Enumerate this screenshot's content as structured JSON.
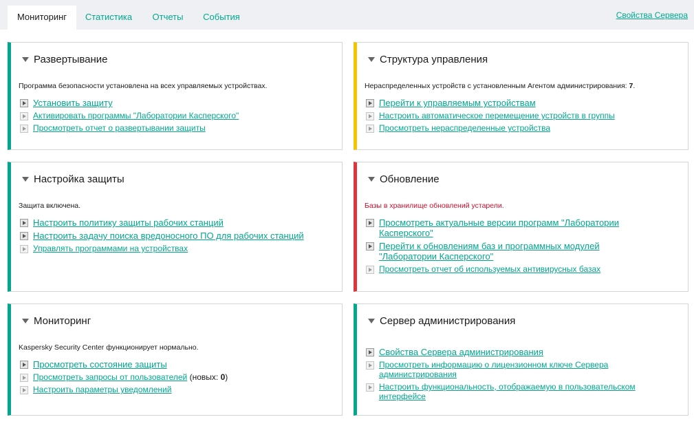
{
  "tabs": {
    "monitoring": "Мониторинг",
    "statistics": "Статистика",
    "reports": "Отчеты",
    "events": "События"
  },
  "server_properties_link": "Свойства Сервера",
  "colors": {
    "accent_green": "#00a88e",
    "warning_yellow": "#f5c400",
    "critical_red": "#e0343e"
  },
  "deployment": {
    "title": "Развертывание",
    "status": "Программа безопасности установлена на всех управляемых устройствах.",
    "links": [
      "Установить защиту",
      "Активировать программы \"Лаборатории Касперского\"",
      "Просмотреть отчет о развертывании защиты"
    ]
  },
  "management": {
    "title": "Структура управления",
    "status_prefix": "Нераспределенных устройств с установленным Агентом администрирования:",
    "status_count": "7",
    "links": [
      "Перейти к управляемым устройствам",
      "Настроить автоматическое перемещение устройств в группы",
      "Просмотреть нераспределенные устройства"
    ]
  },
  "protection": {
    "title": "Настройка защиты",
    "status": "Защита включена.",
    "links": [
      "Настроить политику защиты рабочих станций",
      "Настроить задачу поиска вредоносного ПО для рабочих станций",
      "Управлять программами на устройствах"
    ]
  },
  "update": {
    "title": "Обновление",
    "status": "Базы в хранилище обновлений устарели.",
    "links": [
      "Просмотреть актуальные версии программ \"Лаборатории Касперского\"",
      "Перейти к обновлениям баз и программных модулей \"Лаборатории Касперского\"",
      "Просмотреть отчет об используемых антивирусных базах"
    ]
  },
  "monitoring": {
    "title": "Мониторинг",
    "status": "Kaspersky Security Center функционирует нормально.",
    "links": [
      "Просмотреть состояние защиты",
      "Просмотреть запросы от пользователей",
      "Настроить параметры уведомлений"
    ],
    "requests_new_label": "(новых:",
    "requests_new_count": "0",
    "requests_close": ")"
  },
  "admin_server": {
    "title": "Сервер администрирования",
    "links": [
      "Свойства Сервера администрирования",
      "Просмотреть информацию о лицензионном ключе Сервера администрирования",
      "Настроить функциональность, отображаемую в пользовательском интерфейсе"
    ]
  }
}
